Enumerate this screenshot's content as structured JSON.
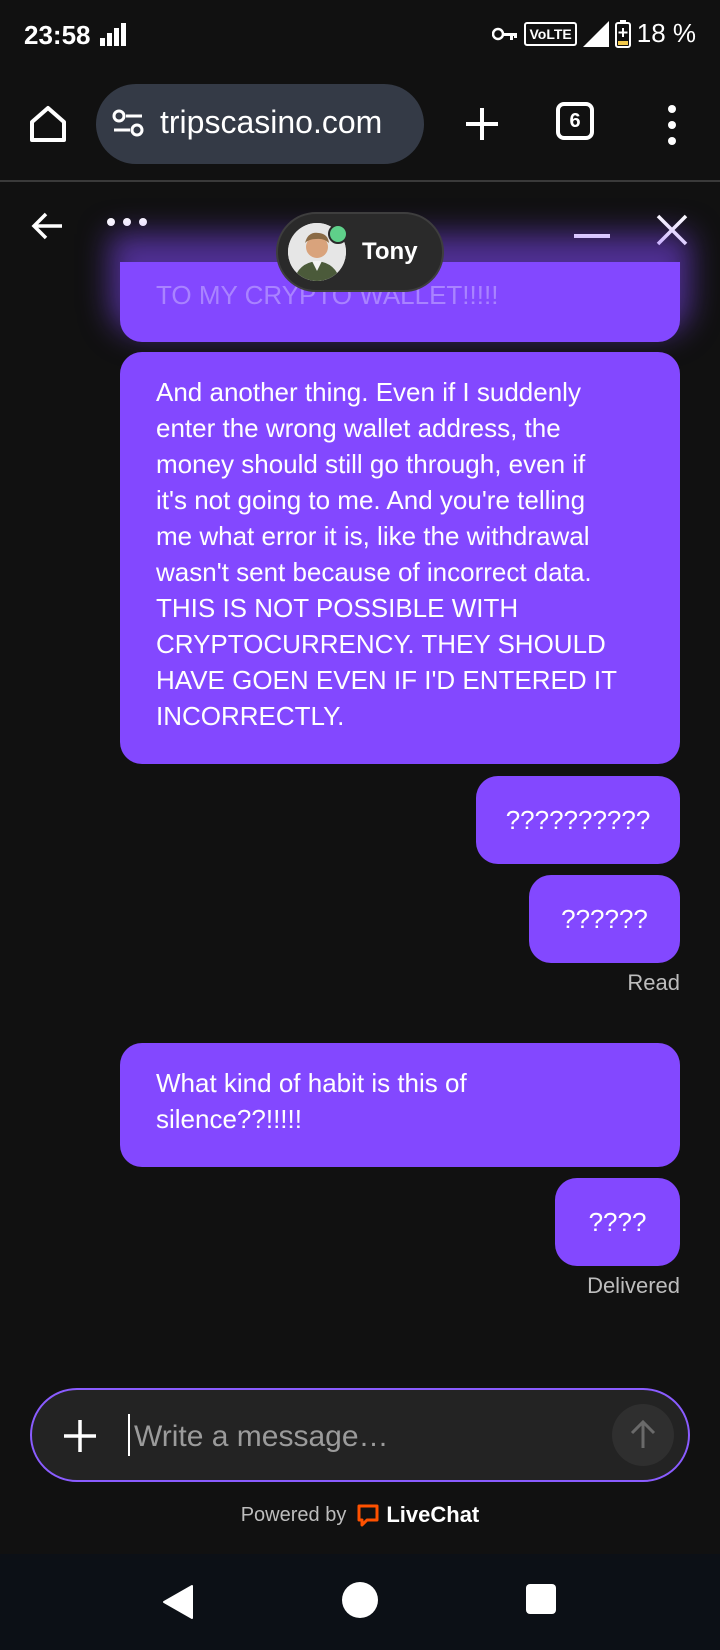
{
  "status_bar": {
    "time": "23:58",
    "battery_percent": "18 %",
    "network_label": "VoLTE"
  },
  "browser": {
    "url": "tripscasino.com",
    "tab_count": "6"
  },
  "chat": {
    "agent_name": "Tony",
    "agent_online": true,
    "messages": [
      {
        "id": "m0",
        "text": "TO MY CRYPTO WALLET!!!!!",
        "partial": true
      },
      {
        "id": "m1",
        "text": "And another thing. Even if I suddenly\nenter the wrong wallet address, the\nmoney should still go through, even if\nit's not going to me. And you're telling\nme what error it is, like the withdrawal\nwasn't sent because of incorrect data.\nTHIS IS NOT POSSIBLE WITH\nCRYPTOCURRENCY. THEY SHOULD\nHAVE GOEN EVEN IF I'D ENTERED IT\nINCORRECTLY."
      },
      {
        "id": "m2",
        "text": "??????????"
      },
      {
        "id": "m3",
        "text": "??????"
      },
      {
        "id": "m4",
        "text": "What kind of habit is this of\nsilence??!!!!!"
      },
      {
        "id": "m5",
        "text": "????"
      }
    ],
    "status_read": "Read",
    "status_delivered": "Delivered"
  },
  "composer": {
    "placeholder": "Write a message…"
  },
  "footer": {
    "powered_by": "Powered by",
    "brand": "LiveChat"
  },
  "colors": {
    "bubble": "#8348ff",
    "background": "#111111",
    "online": "#5fd08a",
    "brand_orange": "#ff5100"
  }
}
